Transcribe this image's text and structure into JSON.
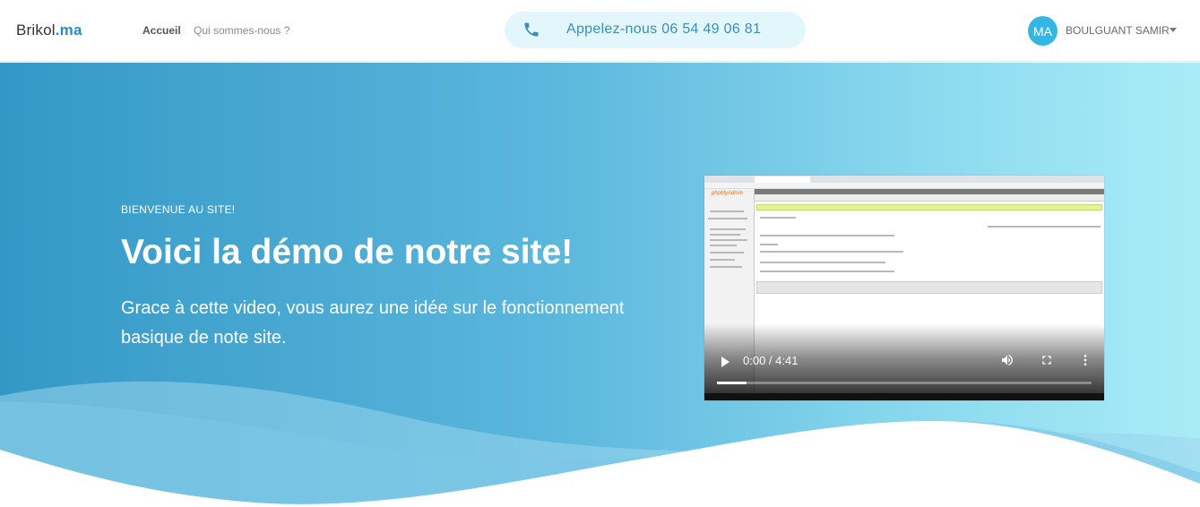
{
  "brand": {
    "name": "Brikol",
    "tld": ".ma"
  },
  "nav": {
    "links": [
      {
        "label": "Accueil",
        "active": true
      },
      {
        "label": "Qui sommes-nous ?",
        "active": false
      }
    ]
  },
  "phone": {
    "label": "Appelez-nous 06 54 49 06 81",
    "icon": "phone-icon"
  },
  "user": {
    "initials": "MA",
    "name": "BOULGUANT SAMIR",
    "dropdown_icon": "caret-down-icon"
  },
  "hero": {
    "eyebrow": "BIENVENUE AU SITE!",
    "title": "Voici la démo de notre site!",
    "subtitle": "Grace à cette video, vous aurez une idée sur le fonctionnement basique de note site."
  },
  "video": {
    "time": "0:00 / 4:41",
    "progress_fraction": 0.08,
    "logo_text": "phpMyAdmin",
    "controls": [
      "play-icon",
      "volume-icon",
      "fullscreen-icon",
      "more-options-icon"
    ]
  },
  "colors": {
    "accent": "#2a8bc7",
    "avatar_bg": "#33b6e4",
    "phone_pill_bg": "#e3f6fc",
    "hero_gradient_start": "#3498c6",
    "hero_gradient_end": "#a9ecf7"
  }
}
